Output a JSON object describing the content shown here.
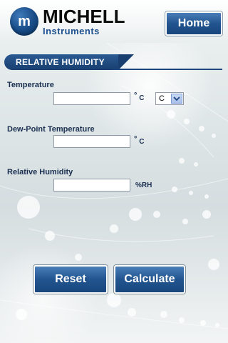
{
  "header": {
    "logo_name": "MICHELL",
    "logo_sub": "Instruments",
    "logo_mark": "m",
    "home_label": "Home"
  },
  "section": {
    "title": "RELATIVE HUMIDITY"
  },
  "form": {
    "temperature": {
      "label": "Temperature",
      "value": "",
      "unit_symbol": "°",
      "unit": "C",
      "unit_select": {
        "selected": "C"
      }
    },
    "dew_point": {
      "label": "Dew-Point Temperature",
      "value": "",
      "unit_symbol": "°",
      "unit": "C"
    },
    "relative_humidity": {
      "label": "Relative Humidity",
      "value": "",
      "unit": "%RH"
    }
  },
  "buttons": {
    "reset_label": "Reset",
    "calculate_label": "Calculate"
  },
  "colors": {
    "brand_blue": "#22558f",
    "label_text": "#1a2f50"
  }
}
